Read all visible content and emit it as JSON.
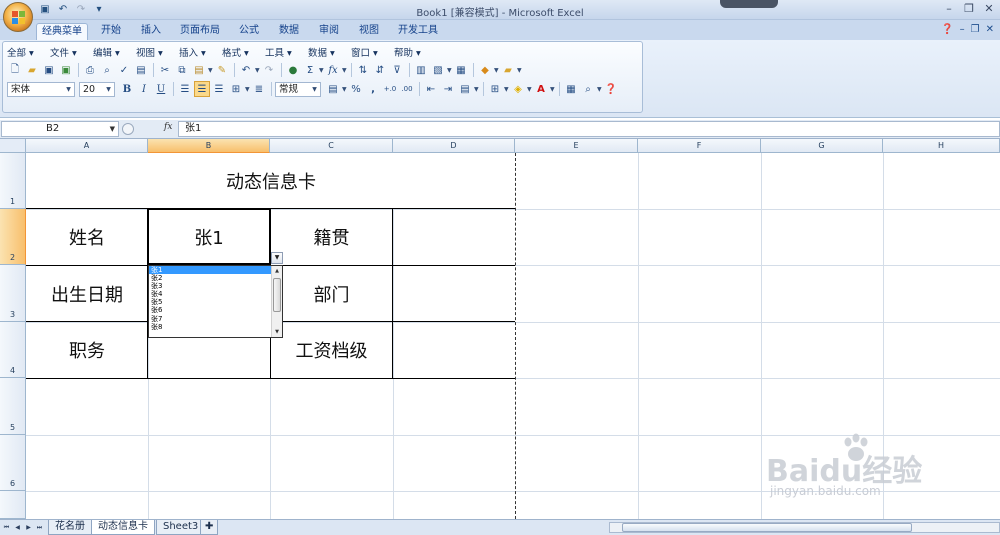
{
  "window": {
    "title": "Book1  [兼容模式] - Microsoft Excel"
  },
  "ribbon_tabs": [
    "经典菜单",
    "开始",
    "插入",
    "页面布局",
    "公式",
    "数据",
    "审阅",
    "视图",
    "开发工具"
  ],
  "menus": [
    "全部 ▾",
    "文件 ▾",
    "编辑 ▾",
    "视图 ▾",
    "插入 ▾",
    "格式 ▾",
    "工具 ▾",
    "数据 ▾",
    "窗口 ▾",
    "帮助 ▾"
  ],
  "toolbar": {
    "font_name": "宋体",
    "font_size": "20",
    "number_format": "常规",
    "bold": "B",
    "italic": "I",
    "underline": "U",
    "percent": "%",
    "comma": ",",
    "sigma": "Σ",
    "fx": "fx"
  },
  "formula_bar": {
    "name_box": "B2",
    "fx_label": "fx",
    "content": "张1"
  },
  "columns": [
    "A",
    "B",
    "C",
    "D",
    "E",
    "F",
    "G",
    "H"
  ],
  "selected_column": "B",
  "rows": [
    "1",
    "2",
    "3",
    "4",
    "5",
    "6"
  ],
  "selected_row": "2",
  "cells": {
    "title": "动态信息卡",
    "a2": "姓名",
    "b2": "张1",
    "c2": "籍贯",
    "a3": "出生日期",
    "c3": "部门",
    "a4": "职务",
    "c4": "工资档级"
  },
  "dropdown": {
    "items": [
      "张1",
      "张2",
      "张3",
      "张4",
      "张5",
      "张6",
      "张7",
      "张8"
    ],
    "highlighted": "张1"
  },
  "sheets": [
    "花名册",
    "动态信息卡",
    "Sheet3"
  ],
  "active_sheet": "动态信息卡",
  "watermark": {
    "logo": "Baidu经验",
    "url": "jingyan.baidu.com"
  },
  "colors": {
    "selection_header": "#f8bf6c",
    "dropdown_highlight": "#3399ff",
    "ribbon_bg": "#dbe6f4"
  }
}
